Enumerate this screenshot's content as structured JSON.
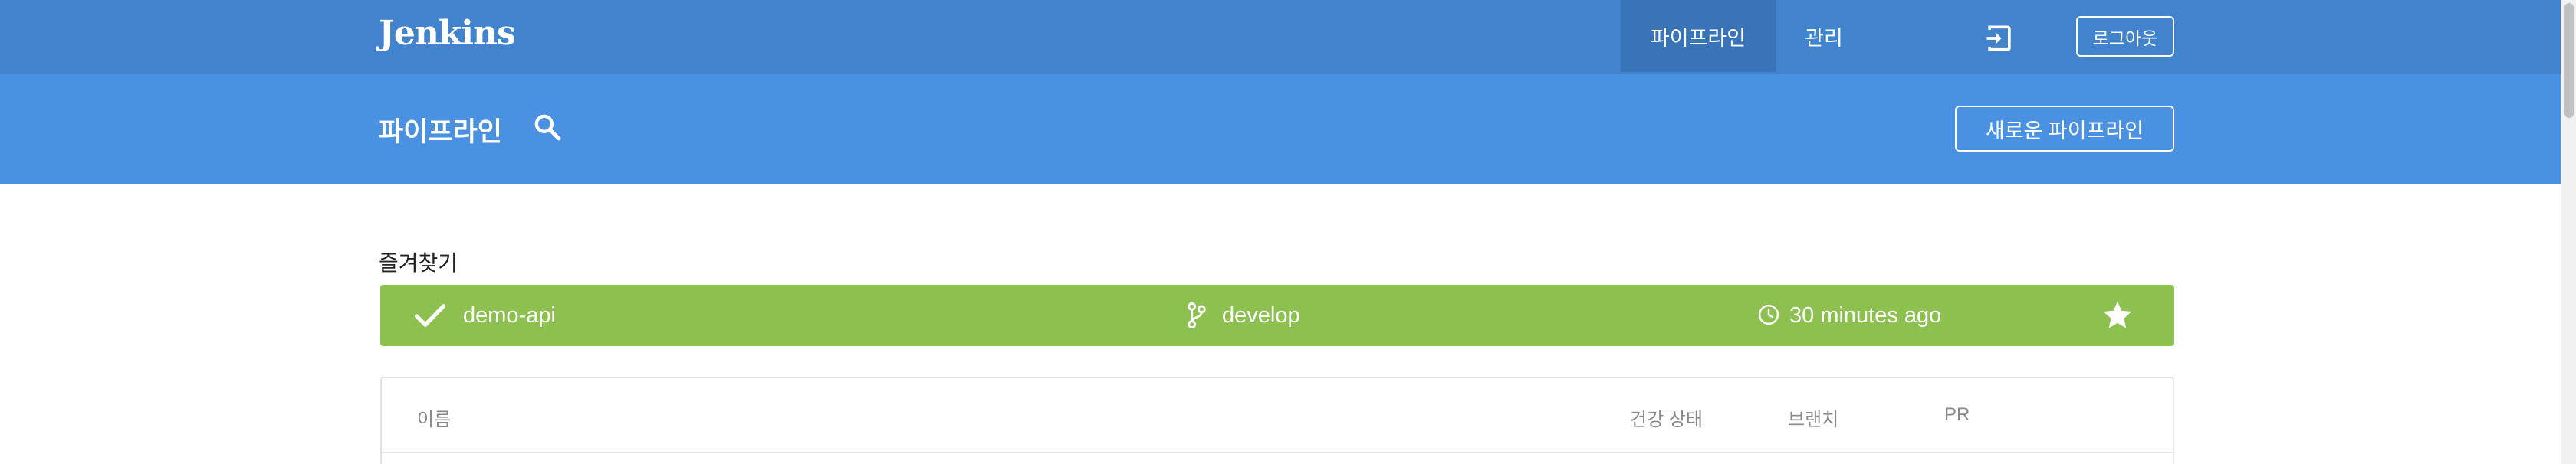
{
  "header": {
    "logo": "Jenkins",
    "tabs": [
      {
        "label": "파이프라인",
        "active": true
      },
      {
        "label": "관리",
        "active": false
      }
    ],
    "logout_icon": "logout-icon",
    "logout_label": "로그아웃"
  },
  "subheader": {
    "title": "파이프라인",
    "search_icon": "search-icon",
    "new_pipeline_label": "새로운 파이프라인"
  },
  "favorites": {
    "heading": "즐겨찾기",
    "items": [
      {
        "status_icon": "check-icon",
        "name": "demo-api",
        "branch_icon": "branch-icon",
        "branch": "develop",
        "time_icon": "clock-icon",
        "time": "30 minutes ago",
        "star_icon": "star-icon",
        "status_color": "#8cc04f"
      }
    ]
  },
  "table": {
    "columns": [
      "이름",
      "건강 상태",
      "브랜치",
      "PR"
    ]
  },
  "colors": {
    "topbar": "#4283ce",
    "subheader": "#4a91e2",
    "success": "#8cc04f"
  }
}
